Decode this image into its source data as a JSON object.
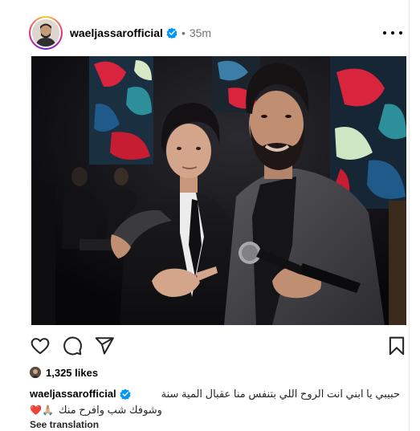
{
  "post": {
    "username": "waeljassarofficial",
    "separator": "•",
    "time": "35m",
    "likes": "1,325 likes",
    "caption_username": "waeljassarofficial",
    "caption_line1": "حبيبي يا ابني انت الروح اللي بتنفس منا عقبال المية سنة",
    "caption_line2": "وشوفك شب وافرح منك",
    "caption_emojis": "❤️🙏🏼",
    "see_translation": "See translation"
  },
  "icons": {
    "verified": "verified-badge-icon",
    "more": "more-options-icon",
    "like": "heart-icon",
    "comment": "comment-icon",
    "share": "paper-plane-icon",
    "save": "bookmark-icon"
  },
  "colors": {
    "verified": "#0095f6",
    "text": "#262626",
    "muted": "#737373",
    "heart_emoji": "#ed3b5a"
  }
}
